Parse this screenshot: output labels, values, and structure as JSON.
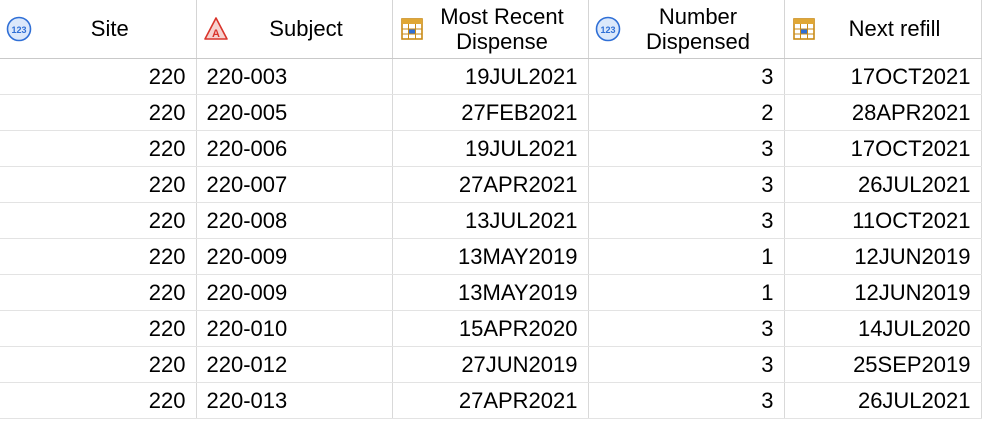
{
  "columns": [
    {
      "key": "site",
      "label": "Site",
      "icon": "numeric-column-icon",
      "two_line": false
    },
    {
      "key": "subject",
      "label": "Subject",
      "icon": "character-column-icon",
      "two_line": false
    },
    {
      "key": "recent",
      "label_line1": "Most Recent",
      "label_line2": "Dispense",
      "icon": "date-column-icon",
      "two_line": true
    },
    {
      "key": "num",
      "label_line1": "Number",
      "label_line2": "Dispensed",
      "icon": "numeric-column-icon",
      "two_line": true
    },
    {
      "key": "refill",
      "label": "Next refill",
      "icon": "date-column-icon",
      "two_line": false
    }
  ],
  "header": {
    "site": "Site",
    "subject": "Subject",
    "recent_line1": "Most Recent",
    "recent_line2": "Dispense",
    "num_line1": "Number",
    "num_line2": "Dispensed",
    "refill": "Next refill"
  },
  "rows": [
    {
      "site": "220",
      "subject": "220-003",
      "recent": "19JUL2021",
      "num": "3",
      "refill": "17OCT2021"
    },
    {
      "site": "220",
      "subject": "220-005",
      "recent": "27FEB2021",
      "num": "2",
      "refill": "28APR2021"
    },
    {
      "site": "220",
      "subject": "220-006",
      "recent": "19JUL2021",
      "num": "3",
      "refill": "17OCT2021"
    },
    {
      "site": "220",
      "subject": "220-007",
      "recent": "27APR2021",
      "num": "3",
      "refill": "26JUL2021"
    },
    {
      "site": "220",
      "subject": "220-008",
      "recent": "13JUL2021",
      "num": "3",
      "refill": "11OCT2021"
    },
    {
      "site": "220",
      "subject": "220-009",
      "recent": "13MAY2019",
      "num": "1",
      "refill": "12JUN2019"
    },
    {
      "site": "220",
      "subject": "220-009",
      "recent": "13MAY2019",
      "num": "1",
      "refill": "12JUN2019"
    },
    {
      "site": "220",
      "subject": "220-010",
      "recent": "15APR2020",
      "num": "3",
      "refill": "14JUL2020"
    },
    {
      "site": "220",
      "subject": "220-012",
      "recent": "27JUN2019",
      "num": "3",
      "refill": "25SEP2019"
    },
    {
      "site": "220",
      "subject": "220-013",
      "recent": "27APR2021",
      "num": "3",
      "refill": "26JUL2021"
    }
  ],
  "colors": {
    "numeric_icon": "#2f6fd6",
    "character_icon": "#d9342b",
    "date_icon": "#c98a16",
    "grid_line": "#d9d9d9"
  }
}
